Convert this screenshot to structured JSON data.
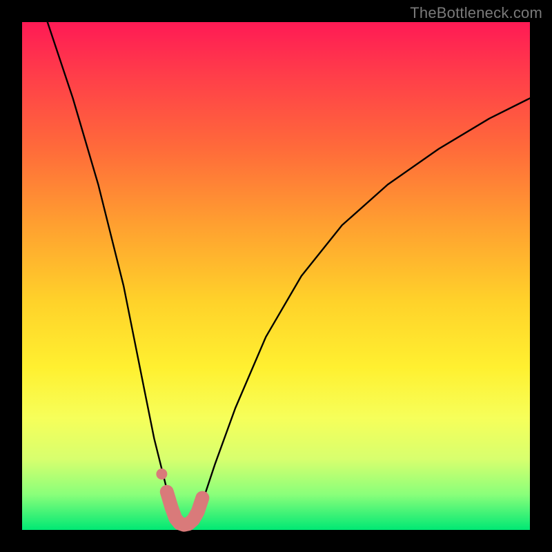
{
  "watermark": {
    "text": "TheBottleneck.com"
  },
  "chart_data": {
    "type": "line",
    "title": "",
    "xlabel": "",
    "ylabel": "",
    "ylim": [
      0,
      100
    ],
    "xlim": [
      0,
      100
    ],
    "series": [
      {
        "name": "curve",
        "x": [
          5,
          10,
          15,
          20,
          22,
          24,
          26,
          28,
          29,
          30,
          31,
          32,
          33,
          34,
          35,
          36,
          38,
          42,
          48,
          55,
          63,
          72,
          82,
          92,
          100
        ],
        "values": [
          100,
          85,
          68,
          48,
          38,
          28,
          18,
          10,
          6,
          3,
          1.5,
          1,
          1.2,
          2,
          4,
          7,
          13,
          24,
          38,
          50,
          60,
          68,
          75,
          81,
          85
        ]
      }
    ],
    "highlight": {
      "name": "bottom-marker",
      "color": "#d97a7a",
      "x": [
        28.5,
        29.4,
        30.2,
        31.0,
        31.9,
        32.8,
        33.7,
        34.6,
        35.5
      ],
      "values": [
        7.5,
        4.5,
        2.3,
        1.3,
        1.0,
        1.2,
        2.0,
        3.6,
        6.3
      ]
    },
    "highlight_dot": {
      "x": 27.5,
      "y": 11,
      "color": "#d97a7a"
    },
    "gradient_stops": [
      {
        "pos": 0,
        "color": "#ff1a55"
      },
      {
        "pos": 25,
        "color": "#ff6b3a"
      },
      {
        "pos": 55,
        "color": "#ffd22a"
      },
      {
        "pos": 78,
        "color": "#f6ff5a"
      },
      {
        "pos": 100,
        "color": "#00e874"
      }
    ]
  }
}
